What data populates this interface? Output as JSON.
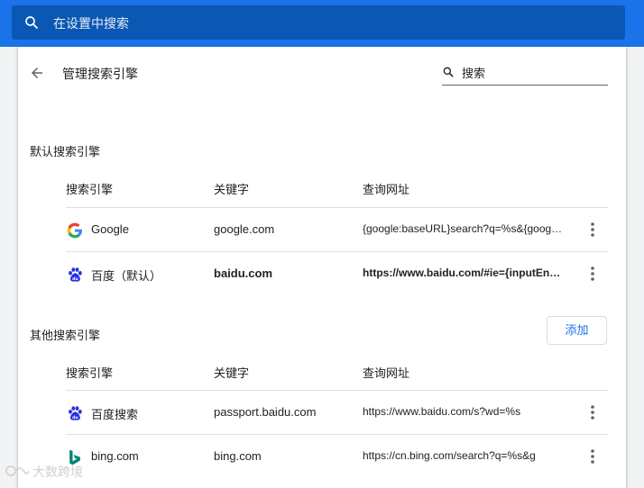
{
  "topbar": {
    "search_placeholder": "在设置中搜索",
    "search_icon": "search-icon"
  },
  "page": {
    "title": "管理搜索引擎",
    "back_icon": "back-arrow-icon",
    "search_placeholder": "搜索"
  },
  "default_section": {
    "title": "默认搜索引擎",
    "columns": [
      "搜索引擎",
      "关键字",
      "查询网址"
    ],
    "rows": [
      {
        "name": "Google",
        "keyword": "google.com",
        "url": "{google:baseURL}search?q=%s&{google:RLZ}",
        "icon": "google-icon"
      },
      {
        "name": "百度（默认）",
        "keyword": "baidu.com",
        "url": "https://www.baidu.com/#ie={inputEncoding}&wd=%s",
        "icon": "baidu-icon",
        "bold": true
      }
    ]
  },
  "other_section": {
    "title": "其他搜索引擎",
    "add_label": "添加",
    "columns": [
      "搜索引擎",
      "关键字",
      "查询网址"
    ],
    "rows": [
      {
        "name": "百度搜索",
        "keyword": "passport.baidu.com",
        "url": "https://www.baidu.com/s?wd=%s",
        "icon": "baidu-icon"
      },
      {
        "name": "bing.com",
        "keyword": "bing.com",
        "url": "https://cn.bing.com/search?q=%s&g",
        "icon": "bing-icon"
      }
    ]
  },
  "watermark": {
    "text": "大数跨境"
  },
  "colors": {
    "accent": "#1a73e8",
    "topbar": "#1a73e8",
    "searchbox": "#0b57b4"
  }
}
